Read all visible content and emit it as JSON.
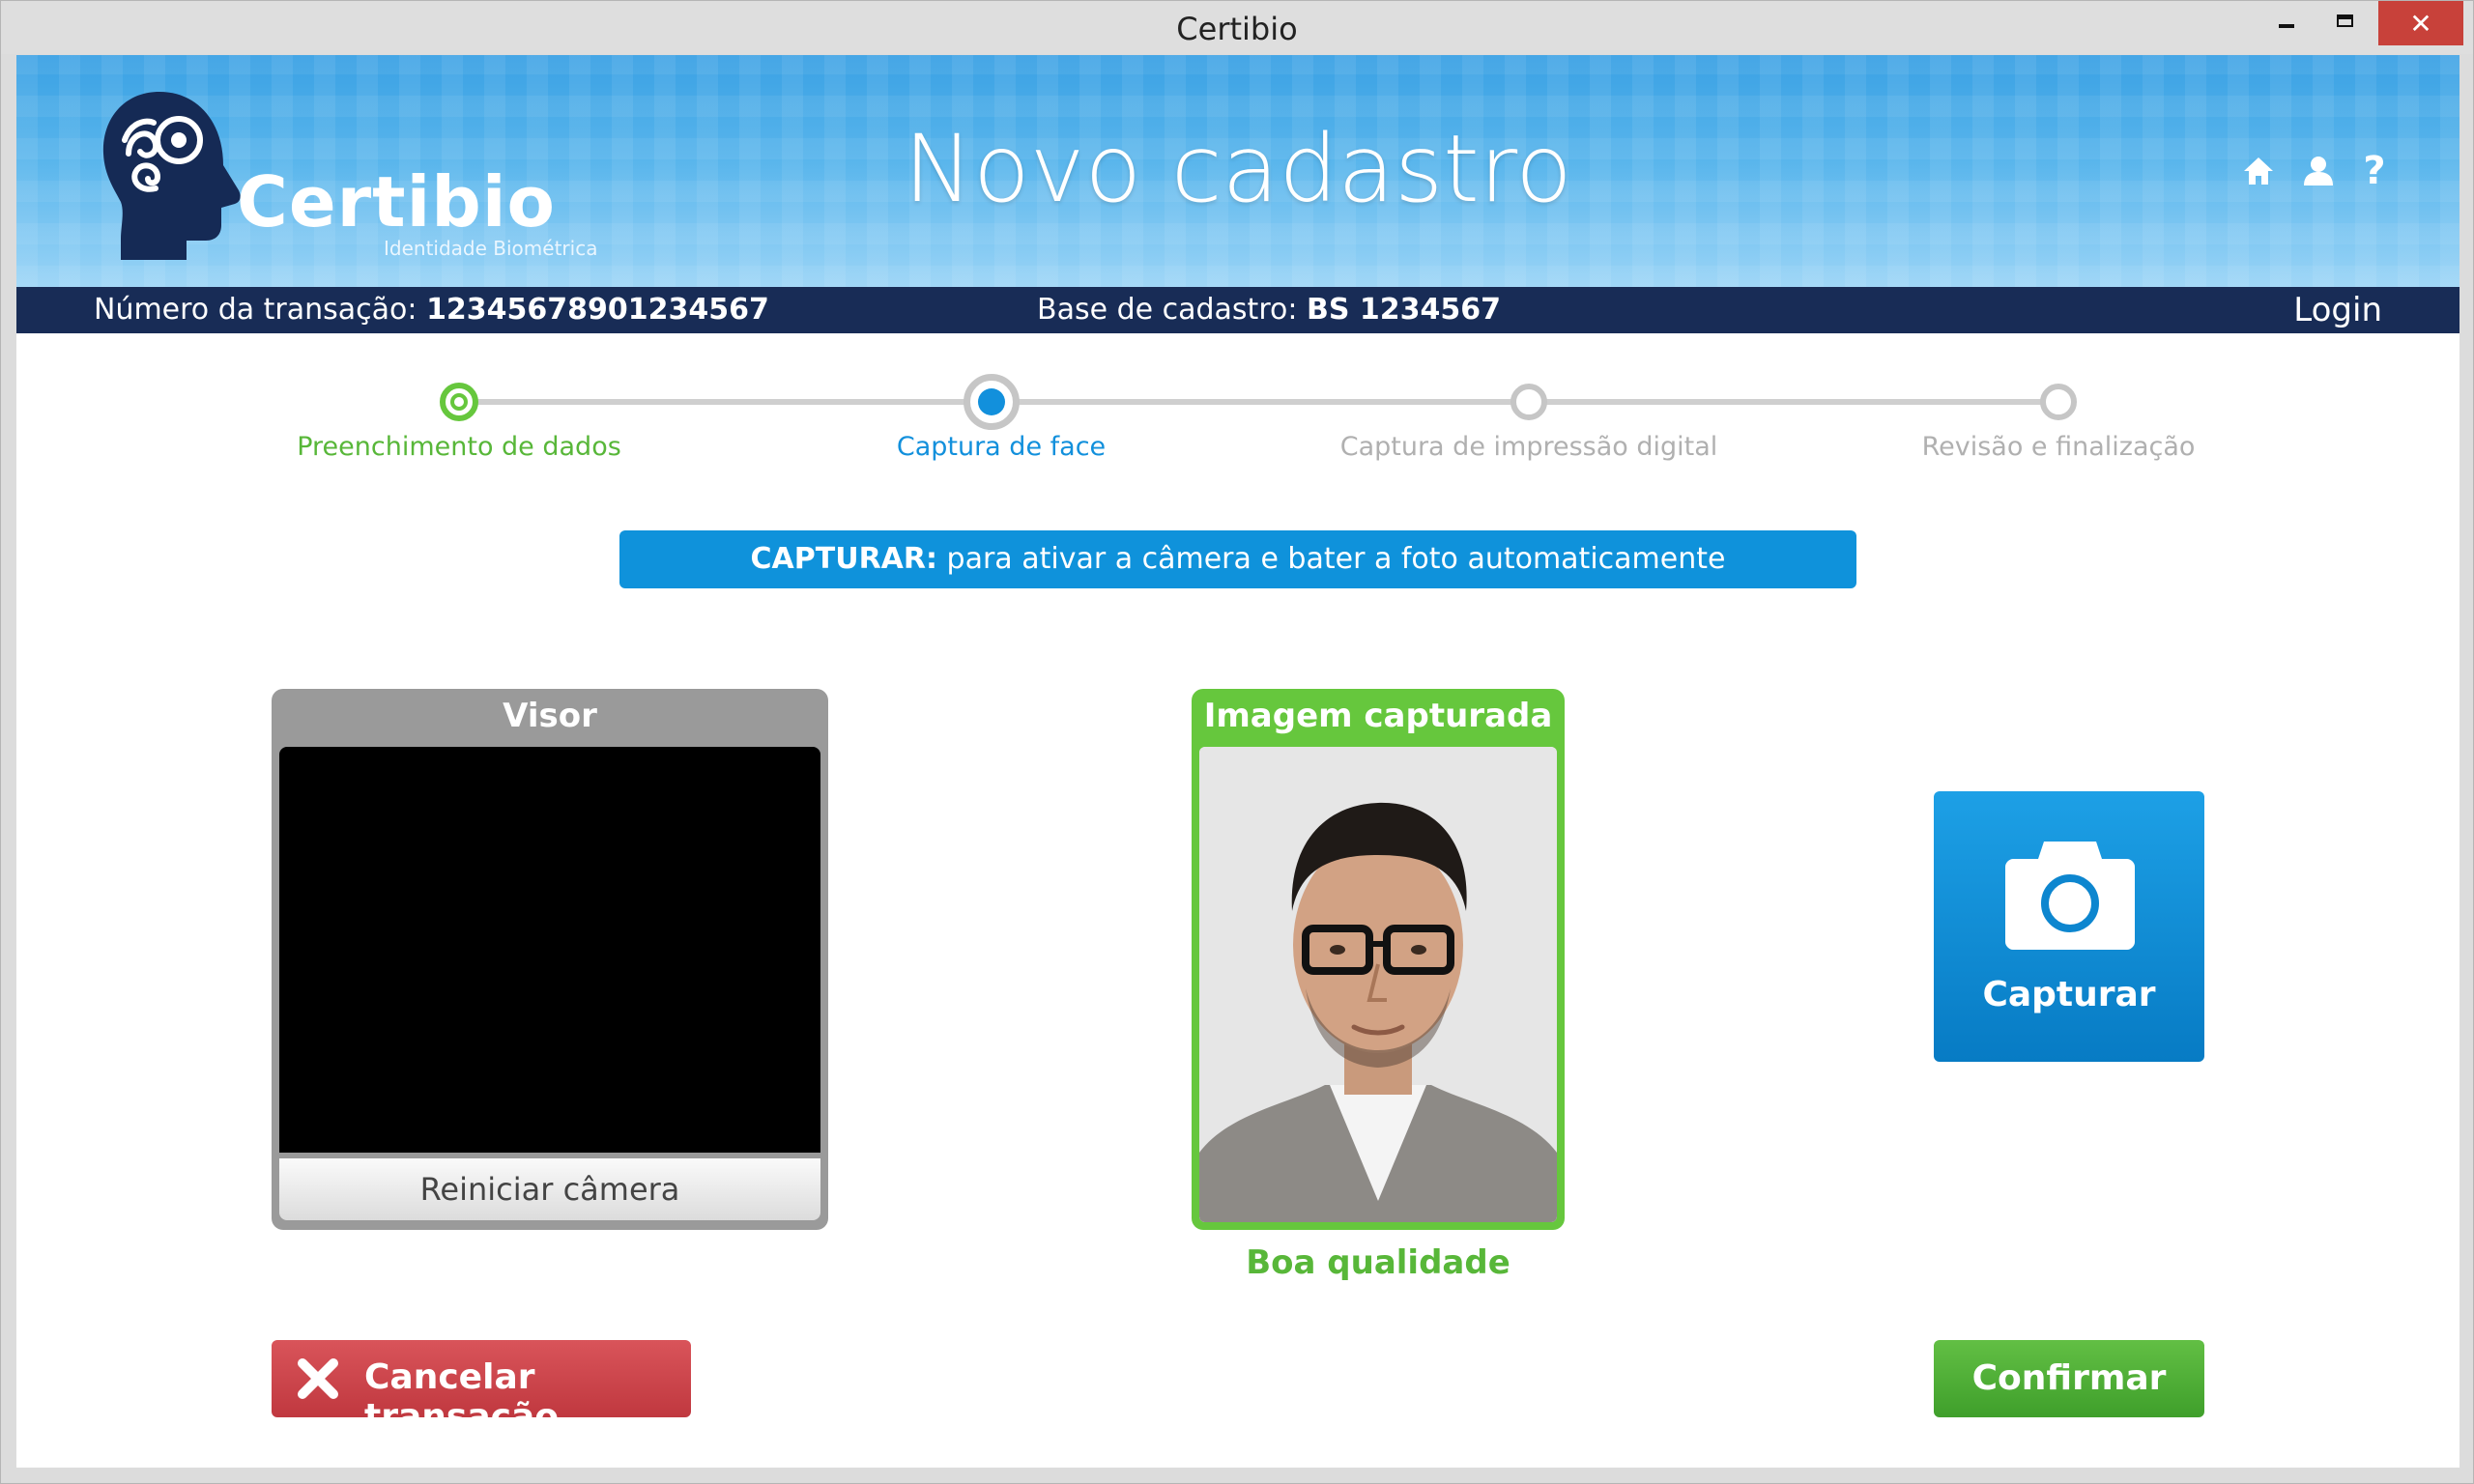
{
  "window": {
    "title": "Certibio",
    "close_glyph": "✕"
  },
  "brand": {
    "name": "Certibio",
    "tagline": "Identidade Biométrica"
  },
  "header": {
    "title": "Novo cadastro",
    "help_glyph": "?"
  },
  "infobar": {
    "transaction_label": "Número da transação: ",
    "transaction_value": "12345678901234567",
    "base_label": "Base de cadastro: ",
    "base_value": "BS 1234567",
    "login": "Login"
  },
  "steps": [
    {
      "label": "Preenchimento de dados",
      "state": "done"
    },
    {
      "label": "Captura de face",
      "state": "current"
    },
    {
      "label": "Captura de impressão digital",
      "state": "pending"
    },
    {
      "label": "Revisão e finalização",
      "state": "pending"
    }
  ],
  "hint": {
    "strong": "CAPTURAR:",
    "text": " para ativar a câmera e bater a foto automaticamente"
  },
  "viewer": {
    "title": "Visor",
    "restart": "Reiniciar câmera"
  },
  "captured": {
    "title": "Imagem capturada",
    "quality": "Boa qualidade"
  },
  "actions": {
    "capture": "Capturar",
    "cancel": "Cancelar transação",
    "confirm": "Confirmar"
  },
  "colors": {
    "accent_blue": "#0f92db",
    "done_green": "#66c73d",
    "danger_red": "#c8413a",
    "dark_navy": "#182c56"
  },
  "icons": [
    "home-icon",
    "user-icon",
    "help-icon",
    "camera-icon",
    "close-x-icon",
    "head-logo-icon"
  ]
}
